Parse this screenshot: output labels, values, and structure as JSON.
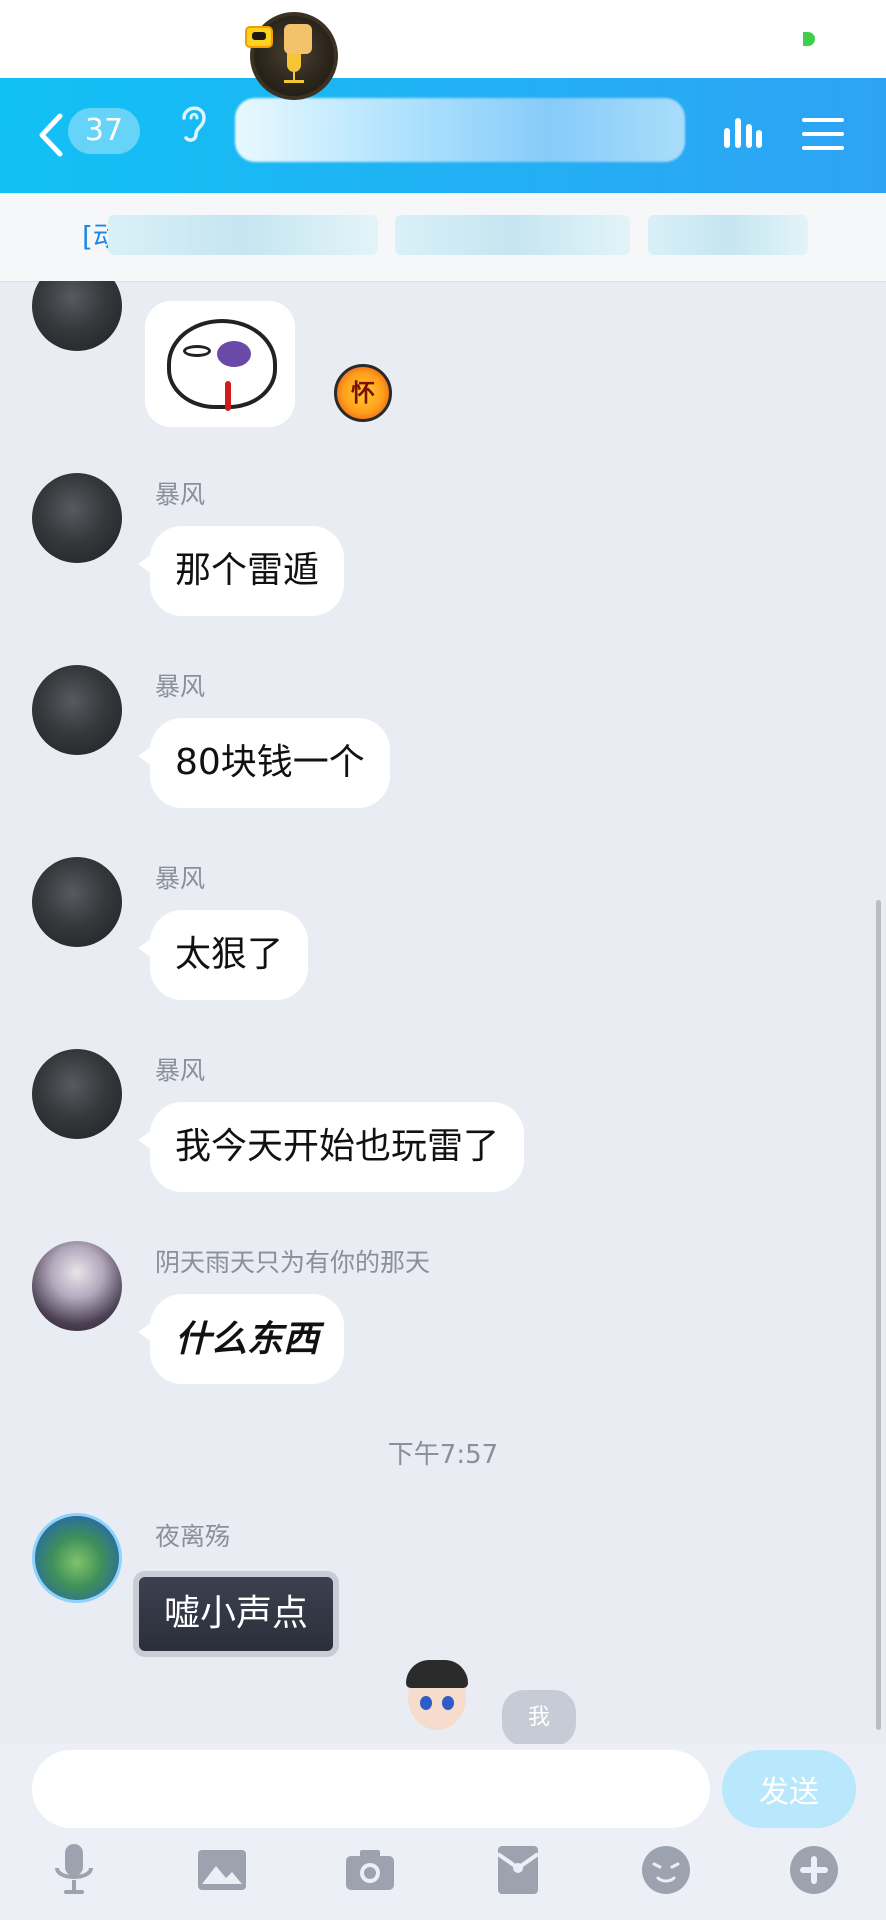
{
  "header": {
    "back_icon": "chevron-left-icon",
    "unread_count": "37",
    "listen_icon": "ear-icon",
    "voice_icon": "voice-room-icon",
    "menu_icon": "menu-icon",
    "accent": "#12bff5"
  },
  "notice": {
    "prefix": "[动"
  },
  "messages": [
    {
      "type": "sticker",
      "sticker_icon": "bruised-face-sticker",
      "badge": "怀"
    },
    {
      "sender": "暴风",
      "text": "那个雷遁"
    },
    {
      "sender": "暴风",
      "text": "80块钱一个"
    },
    {
      "sender": "暴风",
      "text": "太狠了"
    },
    {
      "sender": "暴风",
      "text": "我今天开始也玩雷了"
    },
    {
      "sender": "阴天雨天只为有你的那天",
      "text": "什么东西"
    },
    {
      "type": "time",
      "text": "下午7:57"
    },
    {
      "sender": "夜离殇",
      "text": "嘘小声点"
    }
  ],
  "self_label": "我",
  "input": {
    "value": "",
    "placeholder": "",
    "send_label": "发送",
    "send_color": "#b9e7fb"
  },
  "toolbar": {
    "icons": [
      "microphone-icon",
      "image-icon",
      "camera-icon",
      "red-packet-icon",
      "emoji-icon",
      "plus-icon"
    ]
  }
}
